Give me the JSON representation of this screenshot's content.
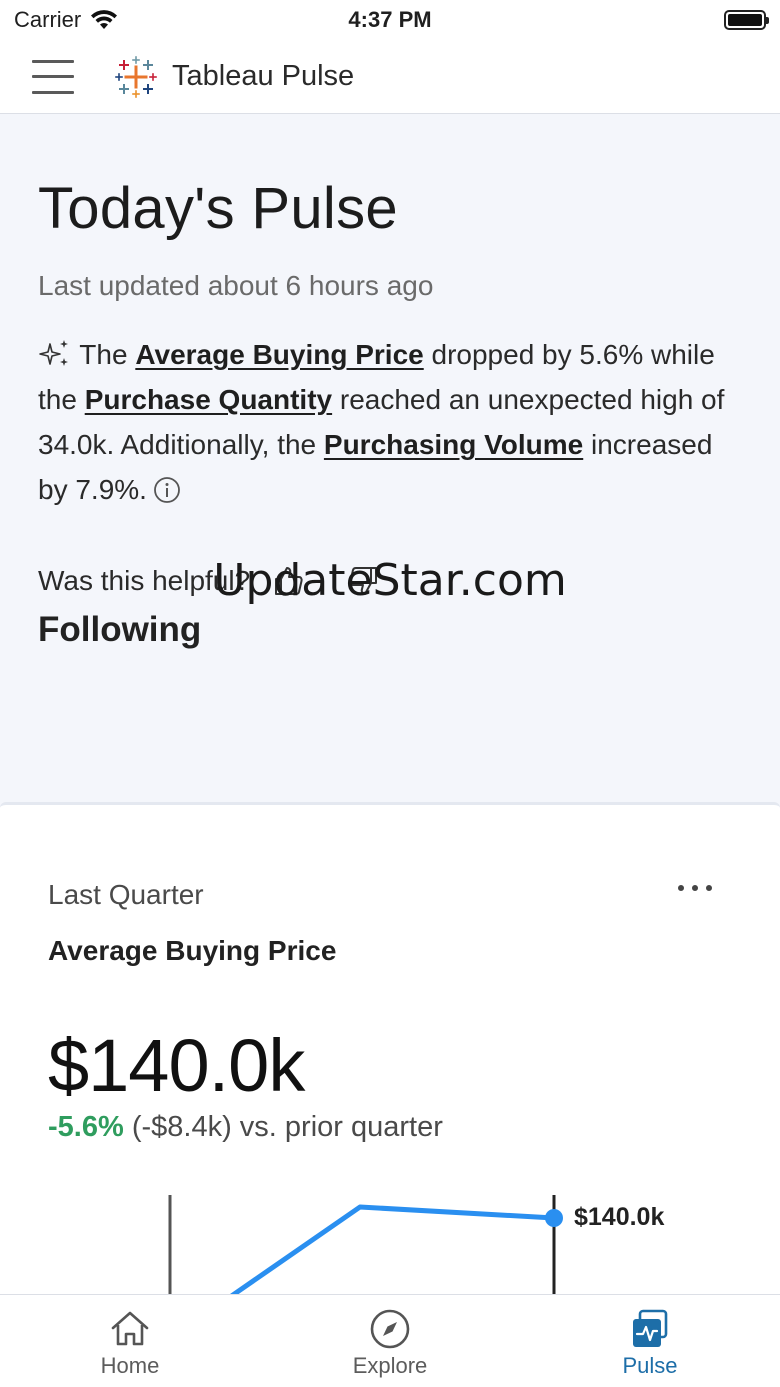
{
  "status_bar": {
    "carrier": "Carrier",
    "time": "4:37 PM"
  },
  "header": {
    "title": "Tableau Pulse",
    "icons": [
      "menu-icon",
      "tableau-logo"
    ]
  },
  "main": {
    "title": "Today's Pulse",
    "last_updated": "Last updated about 6 hours ago",
    "summary": {
      "t1": " The ",
      "link1": "Average Buying Price",
      "t2": " dropped by 5.6% while the ",
      "link2": "Purchase Quantity",
      "t3": " reached an unexpected high of 34.0k. Additionally, the ",
      "link3": "Purchasing Volume",
      "t4": " increased by 7.9%."
    },
    "feedback_question": "Was this helpful?",
    "watermark": "UpdateStar.com",
    "following_heading": "Following"
  },
  "card": {
    "period": "Last Quarter",
    "metric_name": "Average Buying Price",
    "value": "$140.0k",
    "change_pct": "-5.6%",
    "change_rest": " (-$8.4k) vs. prior quarter",
    "last_point_label": "$140.0k"
  },
  "tabs": [
    {
      "label": "Home",
      "icon": "home-icon",
      "active": false
    },
    {
      "label": "Explore",
      "icon": "compass-icon",
      "active": false
    },
    {
      "label": "Pulse",
      "icon": "pulse-icon",
      "active": true
    }
  ],
  "colors": {
    "accent": "#1d6ea8",
    "positive": "#2f9d5e",
    "line": "#2a8ff0",
    "background": "#f4f6fb"
  }
}
